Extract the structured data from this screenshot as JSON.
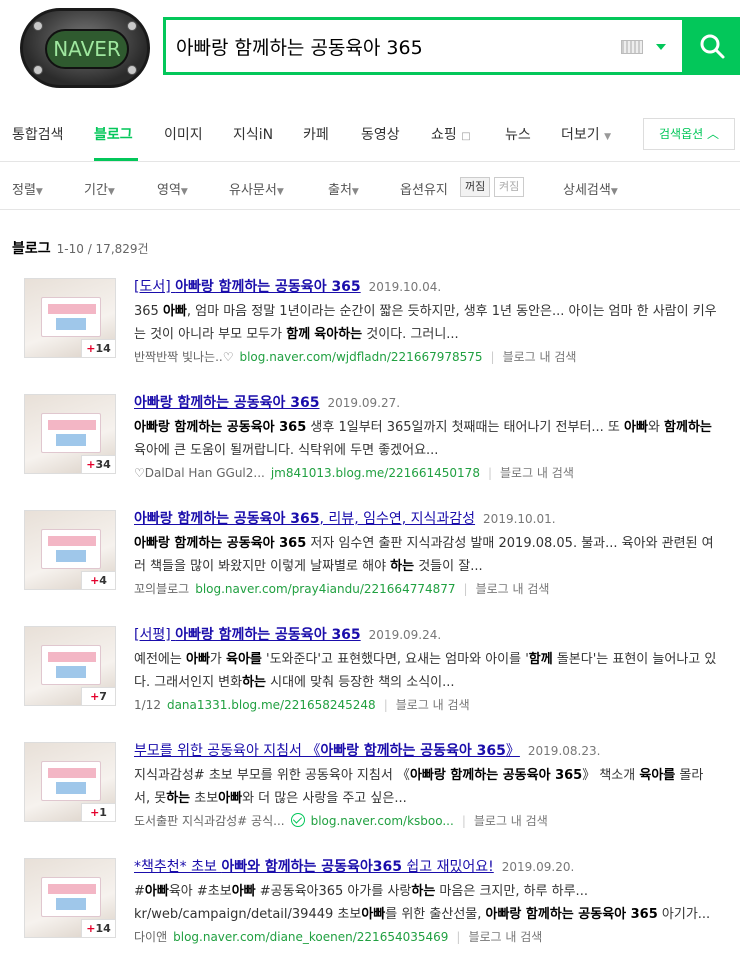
{
  "logo": {
    "text": "NAVER"
  },
  "search": {
    "query": "아빠랑 함께하는 공동육아 365"
  },
  "tabs": [
    {
      "label": "통합검색"
    },
    {
      "label": "블로그"
    },
    {
      "label": "이미지"
    },
    {
      "label": "지식iN"
    },
    {
      "label": "카페"
    },
    {
      "label": "동영상"
    },
    {
      "label": "쇼핑"
    },
    {
      "label": "뉴스"
    },
    {
      "label": "더보기"
    }
  ],
  "search_options_label": "검색옵션",
  "filters": {
    "sort": "정렬",
    "period": "기간",
    "area": "영역",
    "similar": "유사문서",
    "source": "출처",
    "keep_option": "옵션유지",
    "toggle_off": "꺼짐",
    "toggle_on": "켜짐",
    "detail": "상세검색"
  },
  "result_header": {
    "label": "블로그",
    "count": "1-10 / 17,829건"
  },
  "results": [
    {
      "title_prefix": "[도서] ",
      "title_bold": "아빠랑 함께하는 공동육아 365",
      "title_suffix": "",
      "date": "2019.10.04.",
      "desc": "365 아빠, 엄마 마음 정말 1년이라는 순간이 짧은 듯하지만, 생후 1년 동안은... 아이는 엄마 한 사람이 키우는 것이 아니라 부모 모두가 함께 육아하는 것이다. 그러니...",
      "blog_name": "반짝반짝 빛나는..♡",
      "url": "blog.naver.com/wjdfladn/221667978575",
      "blog_search": "블로그 내 검색",
      "badge": "14"
    },
    {
      "title_prefix": "",
      "title_bold": "아빠랑 함께하는 공동육아 365",
      "title_suffix": "",
      "date": "2019.09.27.",
      "desc": "아빠랑 함께하는 공동육아 365 생후 1일부터 365일까지 첫째때는 태어나기 전부터... 또 아빠와 함께하는 육아에 큰 도움이 될꺼랍니다. 식탁위에 두면 좋겠어요...",
      "blog_name": "♡DalDal Han GGul2...",
      "url": "jm841013.blog.me/221661450178",
      "blog_search": "블로그 내 검색",
      "badge": "34"
    },
    {
      "title_prefix": "",
      "title_bold": "아빠랑 함께하는 공동육아 365",
      "title_suffix": ", 리뷰, 임수연, 지식과감성",
      "date": "2019.10.01.",
      "desc": "아빠랑 함께하는 공동육아 365 저자 임수연 출판 지식과감성 발매 2019.08.05. 불과... 육아와 관련된 여러 책들을 많이 봐왔지만 이렇게 날짜별로 해야 하는 것들이 잘...",
      "blog_name": "꼬의블로그",
      "url": "blog.naver.com/pray4iandu/221664774877",
      "blog_search": "블로그 내 검색",
      "badge": "4"
    },
    {
      "title_prefix": "[서평] ",
      "title_bold": "아빠랑 함께하는 공동육아 365",
      "title_suffix": "",
      "date": "2019.09.24.",
      "desc": "예전에는 아빠가 육아를 '도와준다'고 표현했다면, 요새는 엄마와 아이를 '함께 돌본다'는 표현이 늘어나고 있다. 그래서인지 변화하는 시대에 맞춰 등장한 책의 소식이...",
      "blog_name": "1/12",
      "url": "dana1331.blog.me/221658245248",
      "blog_search": "블로그 내 검색",
      "badge": "7"
    },
    {
      "title_prefix": "부모를 위한 공동육아 지침서 《",
      "title_bold": "아빠랑 함께하는 공동육아 365",
      "title_suffix": "》",
      "date": "2019.08.23.",
      "desc": "지식과감성# 초보 부모를 위한 공동육아 지침서 《아빠랑 함께하는 공동육아 365》 책소개 육아를 몰라서, 못하는 초보아빠와 더 많은 사랑을 주고 싶은...",
      "blog_name": "도서출판 지식과감성# 공식...",
      "url": "blog.naver.com/ksboo...",
      "blog_search": "블로그 내 검색",
      "badge": "1"
    },
    {
      "title_prefix": "*책추천* 초보 ",
      "title_bold": "아빠와 함께하는 공동육아365",
      "title_suffix": " 쉽고 재밌어요!",
      "date": "2019.09.20.",
      "desc": "#아빠육아 #초보아빠 #공동육아365 아가를 사랑하는 마음은 크지만, 하루 하루... kr/web/campaign/detail/39449 초보아빠를 위한 출산선물, 아빠랑 함께하는 공동육아 365 아기가...",
      "blog_name": "다이앤",
      "url": "blog.naver.com/diane_koenen/221654035469",
      "blog_search": "블로그 내 검색",
      "badge": "14"
    }
  ]
}
